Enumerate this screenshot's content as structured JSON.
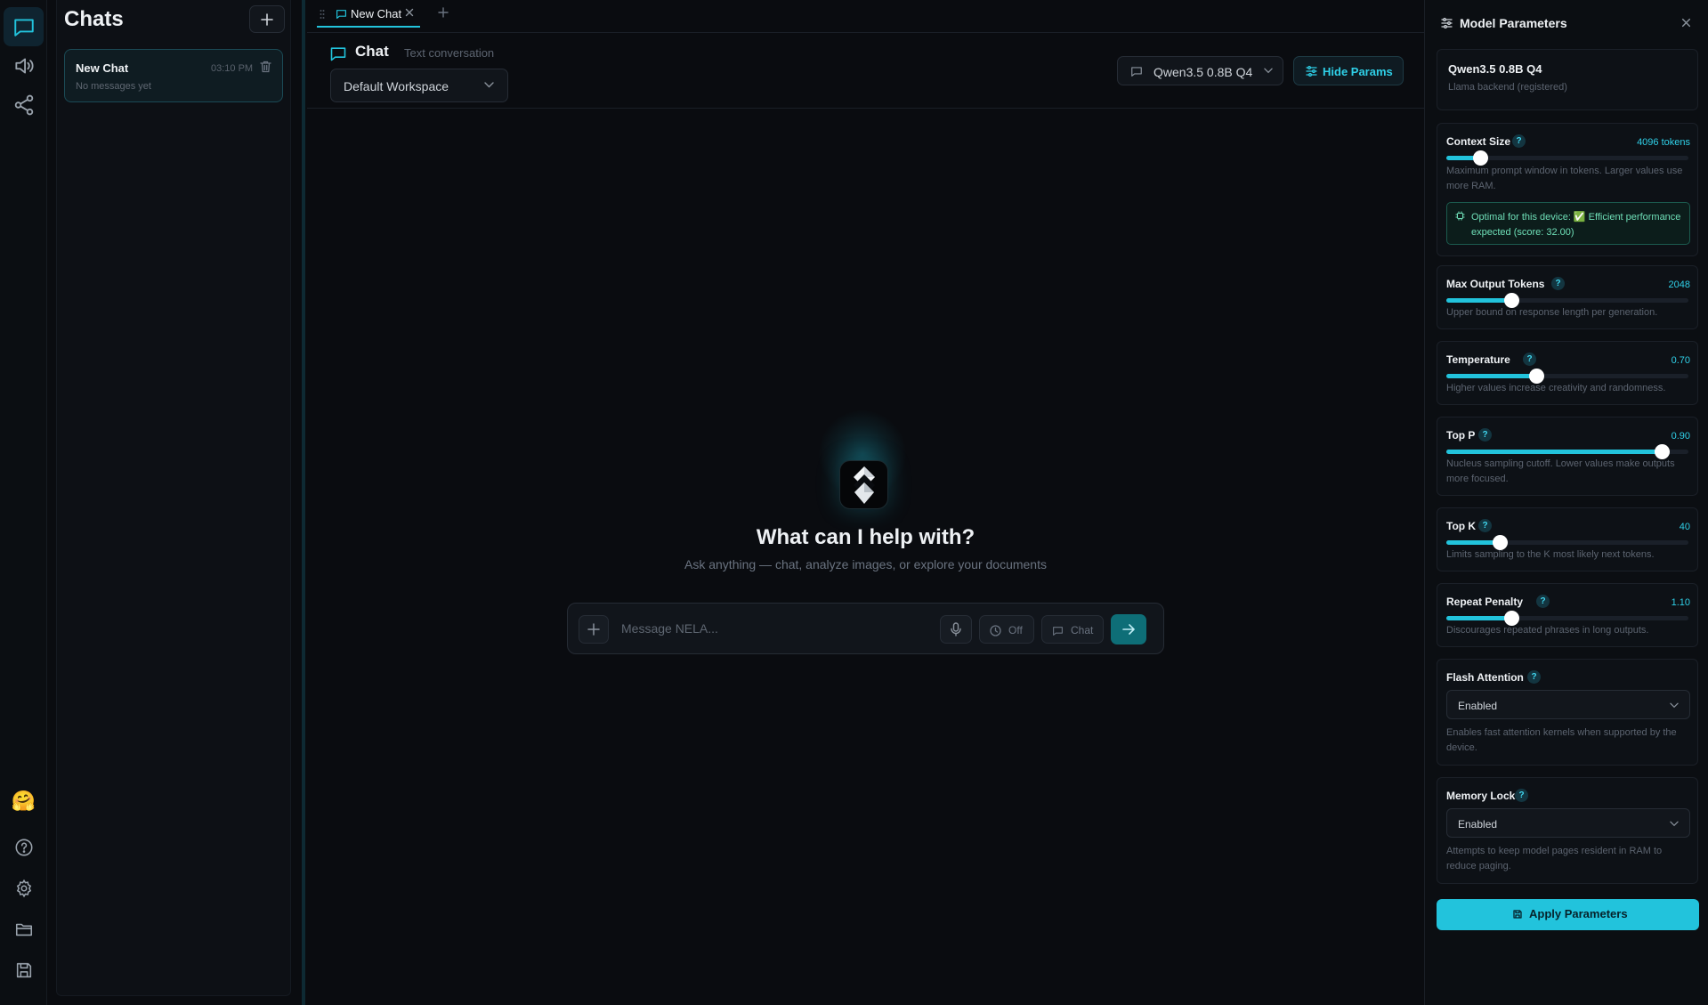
{
  "rail": {
    "items": [
      "chat-icon",
      "speaker-icon",
      "share-icon"
    ],
    "bottom": [
      "hugging-face-icon",
      "help-icon",
      "settings-icon",
      "folder-icon",
      "save-icon"
    ],
    "hf_emoji": "🤗"
  },
  "sidebar": {
    "title": "Chats",
    "chats": [
      {
        "title": "New Chat",
        "time": "03:10 PM",
        "subtitle": "No messages yet"
      }
    ]
  },
  "tabs": [
    {
      "label": "New Chat"
    }
  ],
  "header": {
    "title": "Chat",
    "subtitle": "Text conversation",
    "workspace": "Default Workspace",
    "model": "Qwen3.5 0.8B Q4",
    "hide_params": "Hide Params"
  },
  "welcome": {
    "title": "What can I help with?",
    "subtitle": "Ask anything — chat, analyze images, or explore your documents"
  },
  "composer": {
    "placeholder": "Message NELA...",
    "off_label": "Off",
    "chat_label": "Chat"
  },
  "params": {
    "title": "Model Parameters",
    "model_name": "Qwen3.5 0.8B Q4",
    "backend": "Llama backend (registered)",
    "context": {
      "label": "Context Size",
      "value": "4096 tokens",
      "fraction": 0.14,
      "desc": "Maximum prompt window in tokens. Larger values use more RAM.",
      "notice": "Optimal for this device: ✅ Efficient performance expected (score: 32.00)"
    },
    "max_tokens": {
      "label": "Max Output Tokens",
      "value": "2048",
      "fraction": 0.27,
      "desc": "Upper bound on response length per generation."
    },
    "temperature": {
      "label": "Temperature",
      "value": "0.70",
      "fraction": 0.37,
      "desc": "Higher values increase creativity and randomness."
    },
    "top_p": {
      "label": "Top P",
      "value": "0.90",
      "fraction": 0.89,
      "desc": "Nucleus sampling cutoff. Lower values make outputs more focused."
    },
    "top_k": {
      "label": "Top K",
      "value": "40",
      "fraction": 0.22,
      "desc": "Limits sampling to the K most likely next tokens."
    },
    "repeat_penalty": {
      "label": "Repeat Penalty",
      "value": "1.10",
      "fraction": 0.27,
      "desc": "Discourages repeated phrases in long outputs."
    },
    "flash_attention": {
      "label": "Flash Attention",
      "value": "Enabled",
      "desc": "Enables fast attention kernels when supported by the device."
    },
    "memory_lock": {
      "label": "Memory Lock",
      "value": "Enabled",
      "desc": "Attempts to keep model pages resident in RAM to reduce paging."
    },
    "help_mark": "?",
    "apply": "Apply Parameters"
  },
  "colors": {
    "accent": "#22c3dc",
    "background": "#0a0c10",
    "panel": "#0b0e12"
  }
}
